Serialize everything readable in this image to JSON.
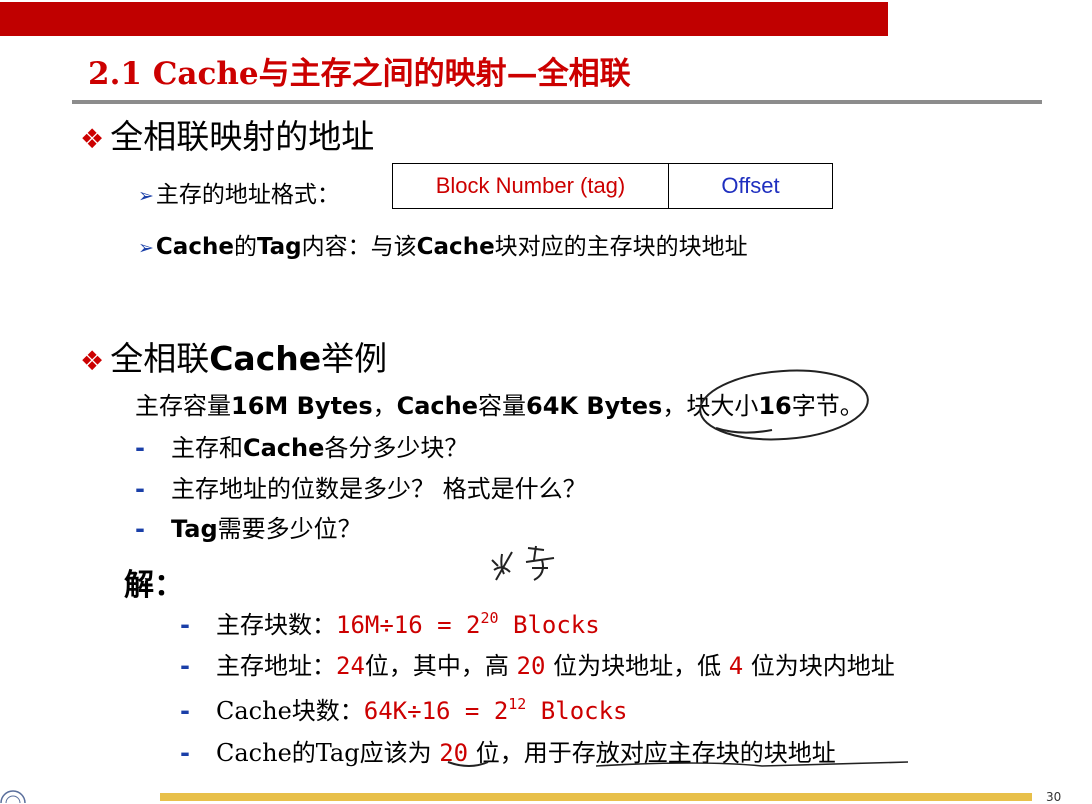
{
  "title": "2.1 Cache与主存之间的映射—全相联",
  "section1": {
    "marker": "❖",
    "heading": "全相联映射的地址",
    "bullet1": {
      "arrow": "➢",
      "label": "主存的地址格式："
    },
    "address_format": {
      "tag": "Block Number (tag)",
      "offset": "Offset"
    },
    "bullet2": {
      "arrow": "➢",
      "prefix": "Cache",
      "mid": "的",
      "tag": "Tag",
      "rest": "内容：与该",
      "cache": "Cache",
      "tail": "块对应的主存块的块地址"
    }
  },
  "section2": {
    "marker": "❖",
    "heading_a": "全相联",
    "heading_b": "Cache",
    "heading_c": "举例",
    "intro": {
      "p1": "主存容量",
      "v1": "16M Bytes",
      "p2": "，",
      "v2": "Cache",
      "p3": "容量",
      "v3": "64K Bytes",
      "p4": "，块大小",
      "v4": "16",
      "p5": "字节。"
    },
    "questions": [
      {
        "dash": "-",
        "a": "主存和",
        "b": "Cache",
        "c": "各分多少块？"
      },
      {
        "dash": "-",
        "a": "主存地址的位数是多少？ 格式是什么？",
        "b": "",
        "c": ""
      },
      {
        "dash": "-",
        "a": "",
        "b": "Tag",
        "c": "需要多少位？"
      }
    ],
    "solution_label": "解：",
    "handwritten_note": "必考",
    "answers": [
      {
        "dash": "-",
        "label": "主存块数：",
        "value": "16M÷16 = 2",
        "exp": "20",
        "tail": " Blocks"
      },
      {
        "dash": "-",
        "label": "主存地址：",
        "v1": "24",
        "t1": "位，其中，高 ",
        "v2": "20",
        "t2": " 位为块地址，低 ",
        "v3": "4",
        "t3": " 位为块内地址"
      },
      {
        "dash": "-",
        "label": "Cache块数：",
        "value": "64K÷16 = 2",
        "exp": "12",
        "tail": " Blocks"
      },
      {
        "dash": "-",
        "label": "Cache的Tag应该为 ",
        "v1": "20",
        "t1": " 位，用于存放对应主存块的块地址"
      }
    ]
  },
  "footer": {
    "page_number": "30"
  },
  "colors": {
    "accent_red": "#c00000",
    "title_red": "#cc0000",
    "blue": "#1f2fbf",
    "footer_gold": "#e8c04a",
    "rule_gray": "#8c8c8c"
  }
}
